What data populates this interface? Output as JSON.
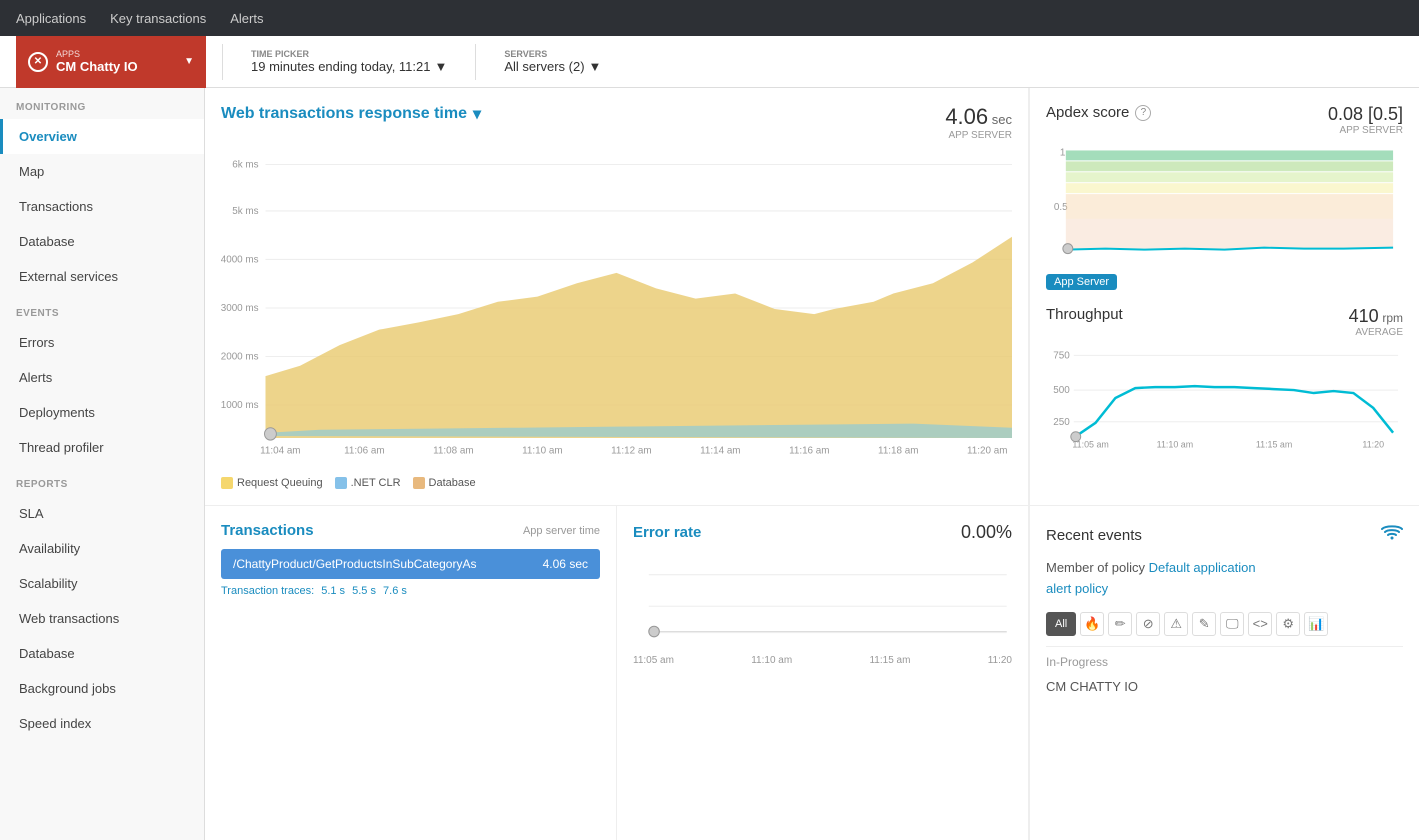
{
  "topNav": {
    "items": [
      "Applications",
      "Key transactions",
      "Alerts"
    ]
  },
  "subHeader": {
    "apps_label": "APPS",
    "app_name": "CM Chatty IO",
    "timePicker": {
      "label": "TIME PICKER",
      "value": "19 minutes ending today, 11:21",
      "chevron": "▼"
    },
    "servers": {
      "label": "SERVERS",
      "value": "All servers (2)",
      "chevron": "▼"
    }
  },
  "sidebar": {
    "monitoring_label": "MONITORING",
    "events_label": "EVENTS",
    "reports_label": "REPORTS",
    "items": {
      "monitoring": [
        "Overview",
        "Map",
        "Transactions",
        "Database",
        "External services"
      ],
      "events": [
        "Errors",
        "Alerts",
        "Deployments",
        "Thread profiler"
      ],
      "reports": [
        "SLA",
        "Availability",
        "Scalability",
        "Web transactions",
        "Database",
        "Background jobs",
        "Speed index"
      ]
    }
  },
  "mainChart": {
    "title": "Web transactions response time",
    "chevron": "▼",
    "stat": {
      "value": "4.06",
      "unit": "sec",
      "sub": "APP SERVER"
    },
    "yLabels": [
      "6k ms",
      "5k ms",
      "4000 ms",
      "3000 ms",
      "2000 ms",
      "1000 ms"
    ],
    "xLabels": [
      "11:04 am",
      "11:06 am",
      "11:08 am",
      "11:10 am",
      "11:12 am",
      "11:14 am",
      "11:16 am",
      "11:18 am",
      "11:20 am"
    ],
    "legend": [
      {
        "label": "Request Queuing",
        "color": "#f5d76e"
      },
      {
        "label": ".NET CLR",
        "color": "#85c1e9"
      },
      {
        "label": "Database",
        "color": "#e8b97e"
      }
    ]
  },
  "apdex": {
    "title": "Apdex score",
    "help": "?",
    "stat": {
      "value": "0.08 [0.5]",
      "sub": "APP SERVER"
    },
    "yLabels": [
      "1",
      "0.5"
    ],
    "badge": "App Server"
  },
  "throughput": {
    "title": "Throughput",
    "stat": {
      "value": "410",
      "unit": "rpm",
      "sub": "AVERAGE"
    },
    "yLabels": [
      "750",
      "500",
      "250"
    ],
    "xLabels": [
      "11:05 am",
      "11:10 am",
      "11:15 am",
      "11:20"
    ]
  },
  "transactions": {
    "title": "Transactions",
    "sub": "App server time",
    "row": {
      "name": "/ChattyProduct/GetProductsInSubCategoryAs",
      "value": "4.06 sec"
    },
    "traces_label": "Transaction traces:",
    "traces": [
      "5.1 s",
      "5.5 s",
      "7.6 s"
    ]
  },
  "errorRate": {
    "title": "Error rate",
    "value": "0.00",
    "unit": "%",
    "xLabels": [
      "11:05 am",
      "11:10 am",
      "11:15 am",
      "11:20"
    ]
  },
  "recentEvents": {
    "title": "Recent events",
    "policy_text": "Member of policy",
    "policy_link": "Default application alert policy",
    "filters": [
      "All",
      "🔥",
      "✏️",
      "⊘",
      "⚠",
      "✎",
      "🖵",
      "<>",
      "⚙",
      "📊"
    ],
    "inProgress": "In-Progress",
    "eventItem": "CM CHATTY IO"
  }
}
